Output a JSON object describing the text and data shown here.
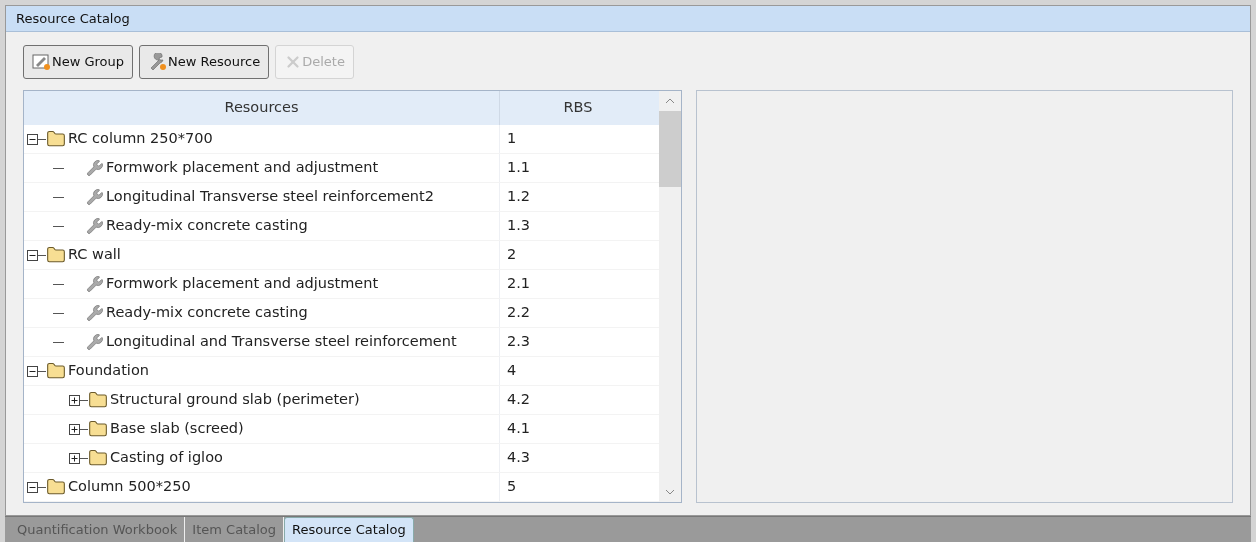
{
  "window": {
    "title": "Resource Catalog"
  },
  "toolbar": [
    {
      "label": "New Group",
      "kind": "group",
      "disabled": false
    },
    {
      "label": "New Resource",
      "kind": "resource",
      "disabled": false
    },
    {
      "label": "Delete",
      "kind": "delete",
      "disabled": true
    }
  ],
  "table": {
    "columns": [
      "Resources",
      "RBS"
    ],
    "rows": [
      {
        "kind": "group",
        "name": "RC column 250*700",
        "rbs": "1",
        "expanded": true,
        "children": [
          {
            "kind": "resource",
            "name": "Formwork placement and adjustment",
            "rbs": "1.1"
          },
          {
            "kind": "resource",
            "name": "Longitudinal Transverse steel reinforcement2",
            "rbs": "1.2"
          },
          {
            "kind": "resource",
            "name": "Ready-mix concrete casting",
            "rbs": "1.3"
          }
        ]
      },
      {
        "kind": "group",
        "name": "RC wall",
        "rbs": "2",
        "expanded": true,
        "children": [
          {
            "kind": "resource",
            "name": "Formwork placement and adjustment",
            "rbs": "2.1"
          },
          {
            "kind": "resource",
            "name": "Ready-mix concrete casting",
            "rbs": "2.2"
          },
          {
            "kind": "resource",
            "name": "Longitudinal and Transverse steel reinforcement",
            "rbs": "2.3"
          }
        ]
      },
      {
        "kind": "group",
        "name": "Foundation",
        "rbs": "4",
        "expanded": true,
        "children": [
          {
            "kind": "group",
            "name": "Structural ground slab (perimeter)",
            "rbs": "4.2",
            "expanded": false
          },
          {
            "kind": "group",
            "name": "Base slab (screed)",
            "rbs": "4.1",
            "expanded": false
          },
          {
            "kind": "group",
            "name": "Casting of igloo",
            "rbs": "4.3",
            "expanded": false
          }
        ]
      },
      {
        "kind": "group",
        "name": "Column 500*250",
        "rbs": "5",
        "expanded": true
      }
    ]
  },
  "tabs": [
    {
      "label": "Quantification Workbook",
      "selected": false
    },
    {
      "label": "Item Catalog",
      "selected": false
    },
    {
      "label": "Resource Catalog",
      "selected": true
    }
  ]
}
